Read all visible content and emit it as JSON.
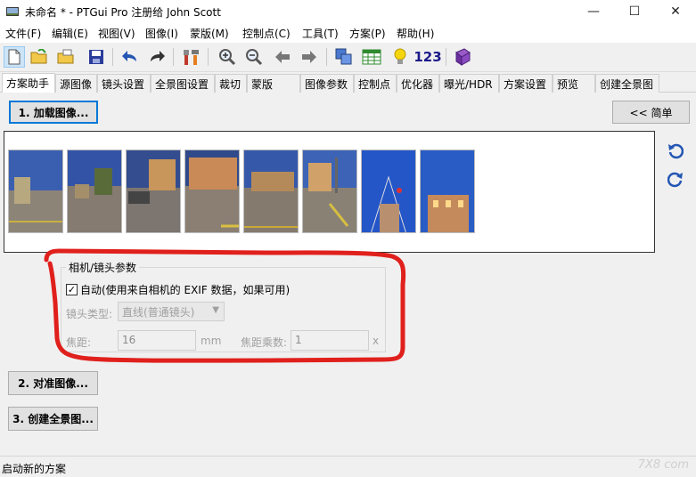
{
  "window": {
    "title": "未命名 * - PTGui Pro 注册给 John Scott",
    "controls": {
      "minimize": "—",
      "maximize": "☐",
      "close": "✕"
    }
  },
  "menu": {
    "items": [
      "文件(F)",
      "编辑(E)",
      "视图(V)",
      "图像(I)",
      "蒙版(M)",
      "控制点(C)",
      "工具(T)",
      "方案(P)",
      "帮助(H)"
    ]
  },
  "toolbar": {
    "counter_label": "123",
    "icons": [
      "new-document-icon",
      "open-folder-icon",
      "open-recent-icon",
      "save-icon",
      "undo-icon",
      "redo-icon",
      "tools-icon",
      "zoom-in-icon",
      "zoom-out-icon",
      "arrow-left-icon",
      "arrow-right-icon",
      "panorama-editor-icon",
      "table-icon",
      "lightbulb-icon",
      "numbers-icon",
      "help-book-icon"
    ]
  },
  "tabs": [
    "方案助手",
    "源图像",
    "镜头设置",
    "全景图设置",
    "裁切",
    "蒙版",
    "图像参数",
    "控制点",
    "优化器",
    "曝光/HDR",
    "方案设置",
    "预览",
    "创建全景图"
  ],
  "active_tab": "方案助手",
  "assistant": {
    "load_images_label": "1. 加载图像...",
    "simple_label": "<< 简单",
    "align_images_label": "2. 对准图像...",
    "create_panorama_label": "3. 创建全景图...",
    "thumbnail_count": 8
  },
  "camera_group": {
    "title": "相机/镜头参数",
    "auto_checked": true,
    "auto_label": "自动(使用来自相机的 EXIF 数据，如果可用)",
    "lens_type_label": "镜头类型:",
    "lens_type_value": "直线(普通镜头)",
    "focal_length_label": "焦距:",
    "focal_length_value": "16",
    "focal_length_unit": "mm",
    "multiplier_label": "焦距乘数:",
    "multiplier_value": "1",
    "multiplier_unit": "x"
  },
  "status": {
    "text": "启动新的方案",
    "watermark": "7X8 com"
  },
  "colors": {
    "annotation_red": "#e0201c",
    "active_tool_bg": "#cce4f7",
    "focus_blue": "#0078d7"
  }
}
